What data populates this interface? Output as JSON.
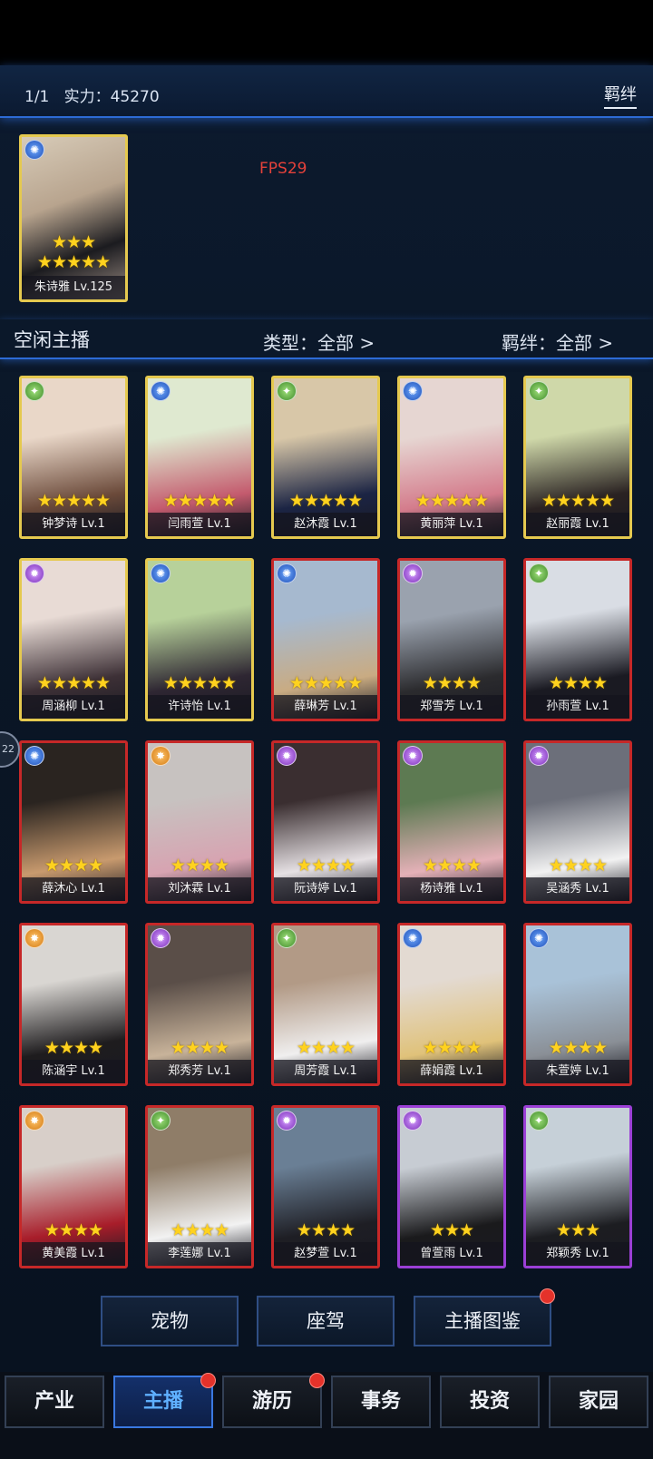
{
  "header": {
    "page_indicator": "1/1",
    "power_label": "实力：",
    "power_value": "45270",
    "bond_link": "羁绊"
  },
  "fps_label": "FPS29",
  "featured": {
    "name": "朱诗雅",
    "level": "Lv.125",
    "stars": 8,
    "badge": "blue"
  },
  "filters": {
    "idle_label": "空闲主播",
    "type_filter": "类型：全部 >",
    "bond_filter": "羁绊：全部 >"
  },
  "side_tab_label": "22",
  "cards": [
    {
      "label": "钟梦诗 Lv.1",
      "stars": 5,
      "frame": "gold",
      "badge": "green",
      "palette": [
        "#e9d7c8",
        "#6b4a3a"
      ]
    },
    {
      "label": "闫雨萱 Lv.1",
      "stars": 5,
      "frame": "gold",
      "badge": "blue",
      "palette": [
        "#dfe9d0",
        "#c45b6e"
      ]
    },
    {
      "label": "赵沐霞 Lv.1",
      "stars": 5,
      "frame": "gold",
      "badge": "green",
      "palette": [
        "#d8c7a8",
        "#1b2444"
      ]
    },
    {
      "label": "黄丽萍 Lv.1",
      "stars": 5,
      "frame": "gold",
      "badge": "blue",
      "palette": [
        "#e6d6d2",
        "#d47c8c"
      ]
    },
    {
      "label": "赵丽霞 Lv.1",
      "stars": 5,
      "frame": "gold",
      "badge": "green",
      "palette": [
        "#cfd8a9",
        "#2a2222"
      ]
    },
    {
      "label": "周涵柳 Lv.1",
      "stars": 5,
      "frame": "gold",
      "badge": "purple",
      "palette": [
        "#e8dbd5",
        "#3d3036"
      ]
    },
    {
      "label": "许诗怡 Lv.1",
      "stars": 5,
      "frame": "gold",
      "badge": "blue",
      "palette": [
        "#b7d19a",
        "#2e2632"
      ]
    },
    {
      "label": "薛琳芳 Lv.1",
      "stars": 5,
      "frame": "red",
      "badge": "blue",
      "palette": [
        "#a6b9cf",
        "#c9ab82"
      ]
    },
    {
      "label": "郑雪芳 Lv.1",
      "stars": 4,
      "frame": "red",
      "badge": "purple",
      "palette": [
        "#9aa2ae",
        "#2b2b2e"
      ]
    },
    {
      "label": "孙雨萱 Lv.1",
      "stars": 4,
      "frame": "red",
      "badge": "green",
      "palette": [
        "#d9dde4",
        "#1a1a22"
      ]
    },
    {
      "label": "薛沐心 Lv.1",
      "stars": 4,
      "frame": "red",
      "badge": "blue",
      "palette": [
        "#2a2420",
        "#c89a6e"
      ]
    },
    {
      "label": "刘沐霖 Lv.1",
      "stars": 4,
      "frame": "red",
      "badge": "orange",
      "palette": [
        "#c7c2c0",
        "#d7a3b1"
      ]
    },
    {
      "label": "阮诗婷 Lv.1",
      "stars": 4,
      "frame": "red",
      "badge": "purple",
      "palette": [
        "#3a2e30",
        "#e6e1e4"
      ]
    },
    {
      "label": "杨诗雅 Lv.1",
      "stars": 4,
      "frame": "red",
      "badge": "purple",
      "palette": [
        "#5d7a52",
        "#e5b1b8"
      ]
    },
    {
      "label": "吴涵秀 Lv.1",
      "stars": 4,
      "frame": "red",
      "badge": "purple",
      "palette": [
        "#6c6f7a",
        "#f2f2f2"
      ]
    },
    {
      "label": "陈涵宇 Lv.1",
      "stars": 4,
      "frame": "red",
      "badge": "orange",
      "palette": [
        "#d9d6d2",
        "#1e1c1e"
      ]
    },
    {
      "label": "郑秀芳 Lv.1",
      "stars": 4,
      "frame": "red",
      "badge": "purple",
      "palette": [
        "#5a4e48",
        "#c8b39a"
      ]
    },
    {
      "label": "周芳霞 Lv.1",
      "stars": 4,
      "frame": "red",
      "badge": "green",
      "palette": [
        "#b29a86",
        "#f0efef"
      ]
    },
    {
      "label": "薛娟霞 Lv.1",
      "stars": 4,
      "frame": "red",
      "badge": "blue",
      "palette": [
        "#e3dad2",
        "#e0c27a"
      ]
    },
    {
      "label": "朱萱婷 Lv.1",
      "stars": 4,
      "frame": "red",
      "badge": "blue",
      "palette": [
        "#a9c2d8",
        "#8a8f96"
      ]
    },
    {
      "label": "黄美霞 Lv.1",
      "stars": 4,
      "frame": "red",
      "badge": "orange",
      "palette": [
        "#d8cfc9",
        "#a81d2a"
      ]
    },
    {
      "label": "李莲娜 Lv.1",
      "stars": 4,
      "frame": "red",
      "badge": "green",
      "palette": [
        "#8f7d68",
        "#f2f2f2"
      ]
    },
    {
      "label": "赵梦萱 Lv.1",
      "stars": 4,
      "frame": "red",
      "badge": "purple",
      "palette": [
        "#6a7f95",
        "#1e1e24"
      ]
    },
    {
      "label": "曾萱雨 Lv.1",
      "stars": 3,
      "frame": "purple",
      "badge": "purple",
      "palette": [
        "#c7ccd3",
        "#1a1a1c"
      ]
    },
    {
      "label": "郑颖秀 Lv.1",
      "stars": 3,
      "frame": "purple",
      "badge": "green",
      "palette": [
        "#c6d0d8",
        "#1c1d21"
      ]
    }
  ],
  "actions": {
    "pet": "宠物",
    "mount": "座驾",
    "gallery": "主播图鉴"
  },
  "nav": {
    "industry": "产业",
    "anchor": "主播",
    "travel": "游历",
    "affairs": "事务",
    "invest": "投资",
    "home": "家园"
  },
  "colors": {
    "accent_blue": "#2d6bd6",
    "star_yellow": "#ffd21e",
    "frame_gold": "#e5c94f",
    "frame_red": "#c62828",
    "frame_purple": "#9b3fd6",
    "notification_red": "#e4322a",
    "fps_red": "#e4413a"
  }
}
